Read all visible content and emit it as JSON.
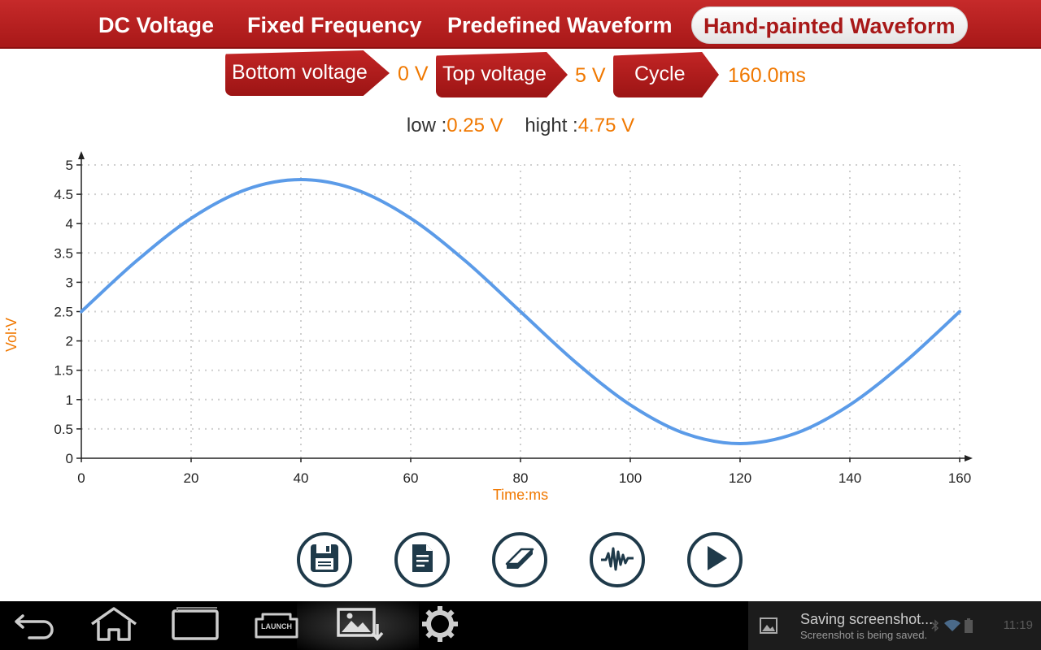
{
  "tabs": [
    {
      "label": "DC Voltage",
      "active": false
    },
    {
      "label": "Fixed Frequency",
      "active": false
    },
    {
      "label": "Predefined Waveform",
      "active": false
    },
    {
      "label": "Hand-painted Waveform",
      "active": true
    }
  ],
  "params": {
    "bottom_label": "Bottom voltage",
    "bottom_value": "0 V",
    "top_label": "Top voltage",
    "top_value": "5 V",
    "cycle_label": "Cycle",
    "cycle_value": "160.0ms"
  },
  "limits": {
    "low_label": "low :",
    "low_value": "0.25 V",
    "high_label": "hight :",
    "high_value": "4.75 V"
  },
  "chart_data": {
    "type": "line",
    "xlabel": "Time:ms",
    "ylabel": "Vol:V",
    "xlim": [
      0,
      160
    ],
    "ylim": [
      0,
      5
    ],
    "xticks": [
      "0",
      "20",
      "40",
      "60",
      "80",
      "100",
      "120",
      "140",
      "160"
    ],
    "yticks": [
      "0",
      "0.5",
      "1",
      "1.5",
      "2",
      "2.5",
      "3",
      "3.5",
      "4",
      "4.5",
      "5"
    ],
    "grid": true,
    "line_color": "#5b9be8",
    "series": [
      {
        "x": [
          0,
          10,
          20,
          30,
          40,
          50,
          60,
          70,
          80,
          90,
          100,
          110,
          120,
          130,
          140,
          150,
          160
        ],
        "y": [
          2.5,
          3.36,
          4.09,
          4.58,
          4.75,
          4.58,
          4.09,
          3.36,
          2.5,
          1.64,
          0.91,
          0.42,
          0.25,
          0.42,
          0.91,
          1.64,
          2.5
        ]
      }
    ]
  },
  "actions": [
    {
      "name": "save-icon"
    },
    {
      "name": "document-icon"
    },
    {
      "name": "eraser-icon"
    },
    {
      "name": "waveform-icon"
    },
    {
      "name": "play-icon"
    }
  ],
  "navbar": {
    "launch_label": "LAUNCH",
    "notification_title": "Saving screenshot...",
    "notification_sub": "Screenshot is being saved.",
    "time": "11:19"
  },
  "colors": {
    "brand_red": "#b21c1c",
    "value_orange": "#f07800",
    "icon_dark": "#1f3a4a"
  }
}
